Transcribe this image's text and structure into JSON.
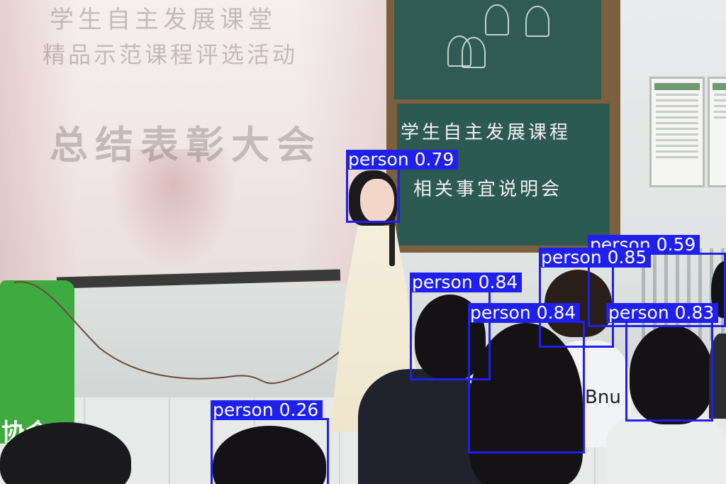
{
  "image": {
    "screen_lines": [
      "学生自主发展课堂",
      "精品示范课程评选活动",
      "总结表彰大会"
    ],
    "board_lines": [
      "学生自主发展课程",
      "相关事宜说明会"
    ],
    "banner_text": "协会",
    "shirt_text": "Bnu"
  },
  "detections": [
    {
      "label": "person 0.79",
      "class": "person",
      "score": 0.79
    },
    {
      "label": "person 0.59",
      "class": "person",
      "score": 0.59
    },
    {
      "label": "person 0.85",
      "class": "person",
      "score": 0.85
    },
    {
      "label": "person 0.84",
      "class": "person",
      "score": 0.84
    },
    {
      "label": "person 0.84",
      "class": "person",
      "score": 0.84
    },
    {
      "label": "person 0.83",
      "class": "person",
      "score": 0.83
    },
    {
      "label": "person 0.26",
      "class": "person",
      "score": 0.26
    }
  ],
  "colors": {
    "box": "#1f1fee",
    "label_text": "#ffffff"
  }
}
